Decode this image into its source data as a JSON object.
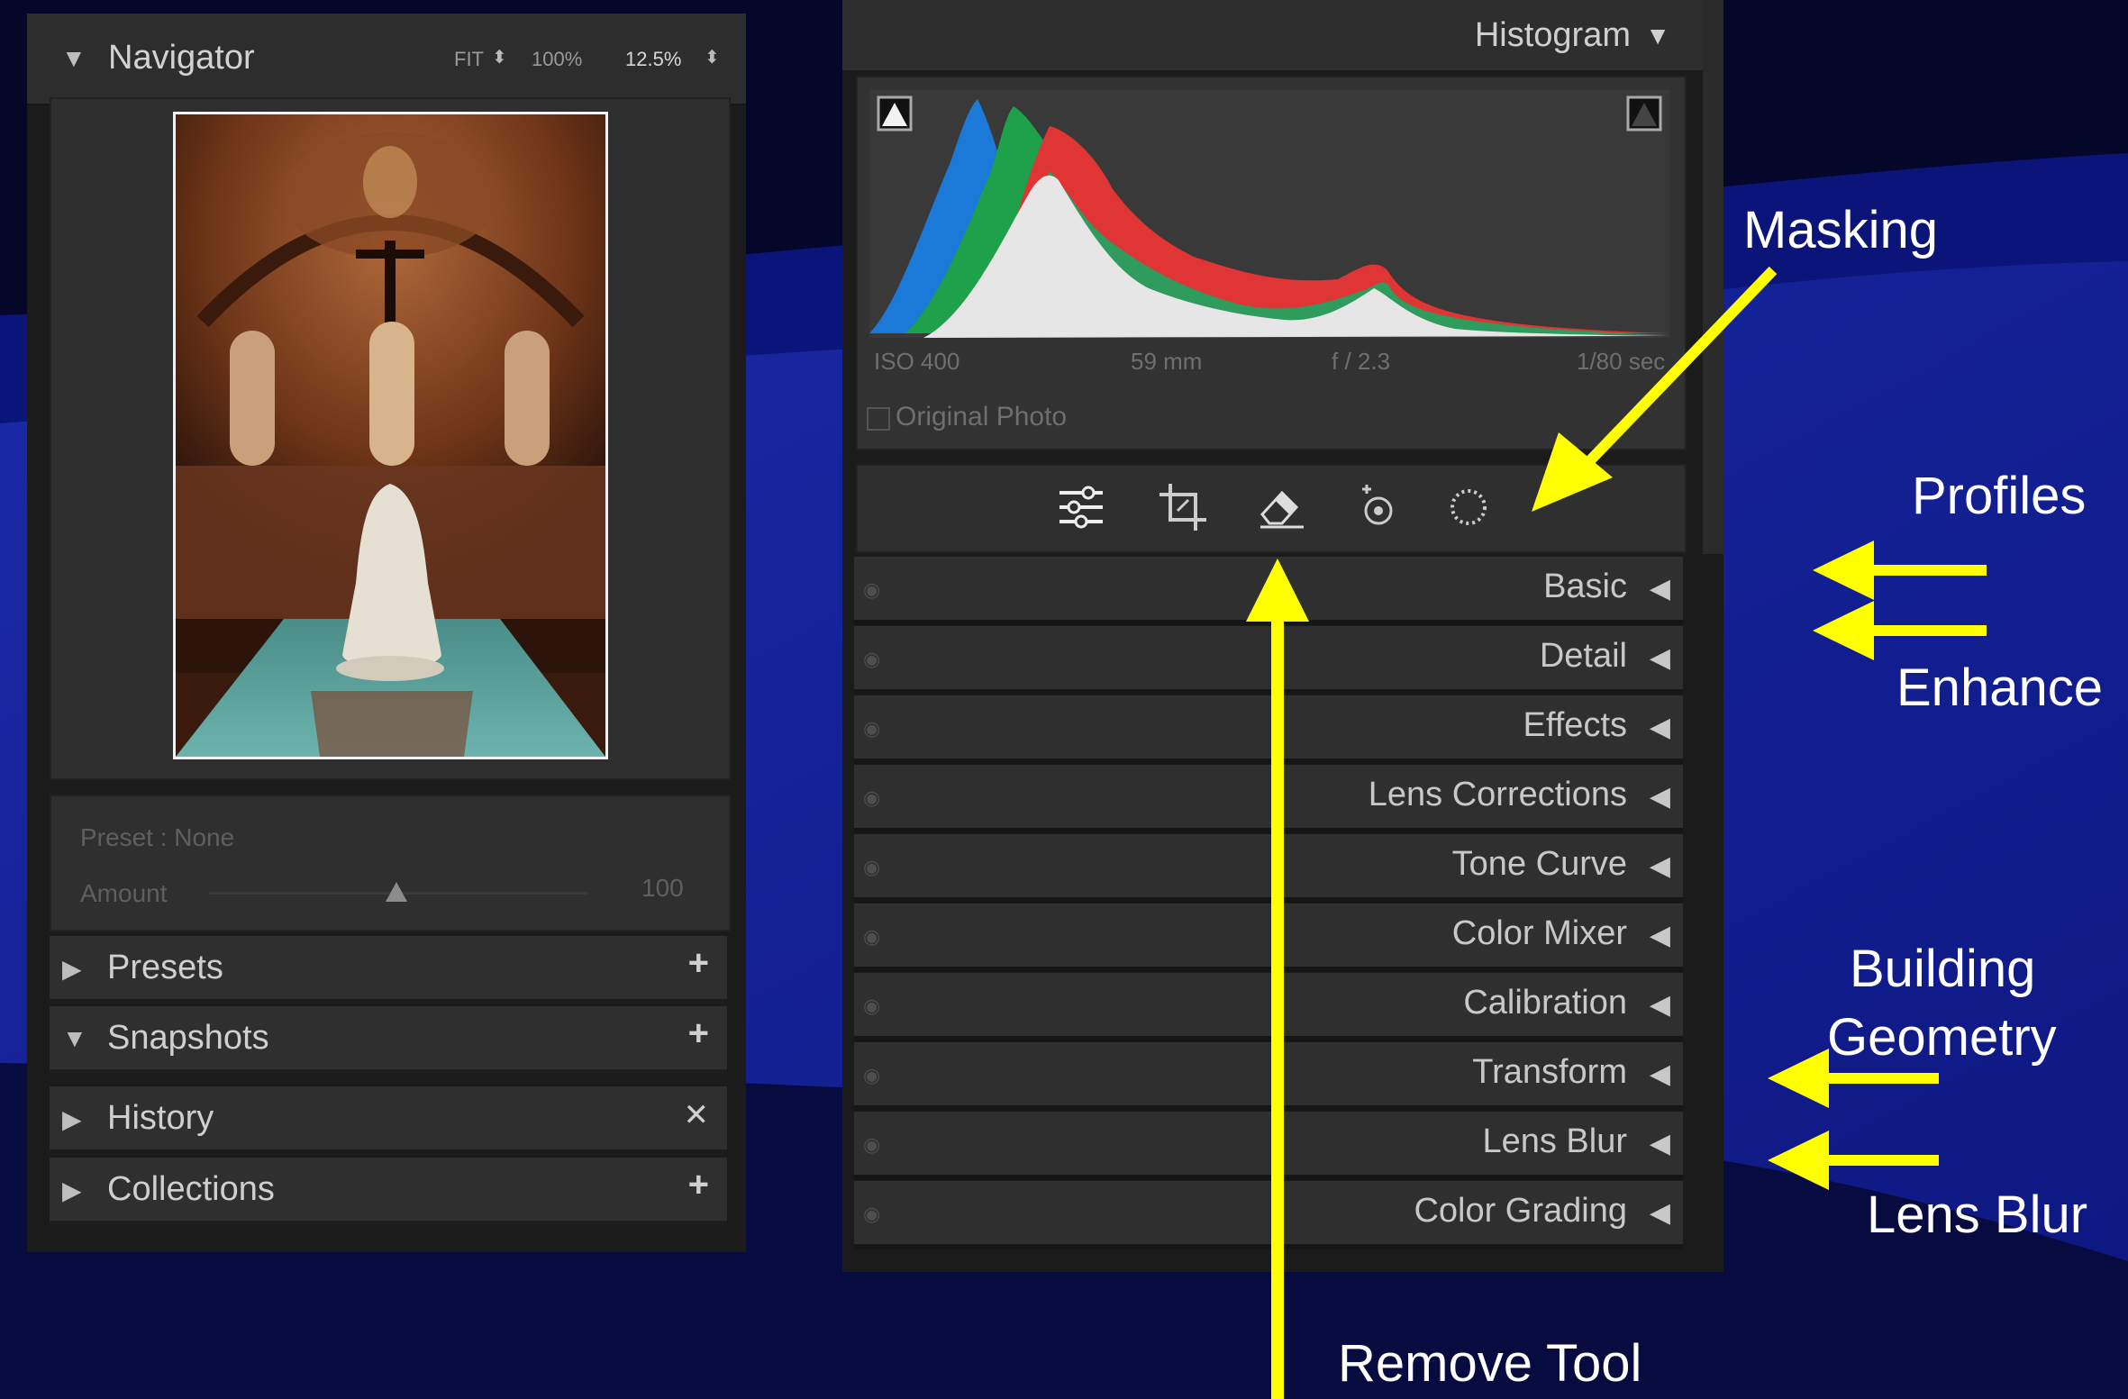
{
  "left_panel": {
    "navigator": {
      "title": "Navigator",
      "zoom_options": [
        "FIT",
        "100%",
        "12.5%"
      ]
    },
    "preset": {
      "label": "Preset : None",
      "amount_label": "Amount",
      "amount_value": "100",
      "amount_fraction": 0.5
    },
    "sections": [
      {
        "label": "Presets",
        "expanded": false,
        "action_icon": "plus-icon"
      },
      {
        "label": "Snapshots",
        "expanded": true,
        "action_icon": "plus-icon"
      },
      {
        "label": "History",
        "expanded": false,
        "action_icon": "close-icon"
      },
      {
        "label": "Collections",
        "expanded": false,
        "action_icon": "plus-icon"
      }
    ]
  },
  "right_panel": {
    "histogram": {
      "title": "Histogram",
      "iso": "ISO 400",
      "focal": "59 mm",
      "aperture": "f / 2.3",
      "shutter": "1/80 sec",
      "original_photo": "Original Photo"
    },
    "tools": [
      "edit-sliders-icon",
      "crop-icon",
      "remove-eraser-icon",
      "red-eye-icon",
      "masking-icon"
    ],
    "panels": [
      "Basic",
      "Detail",
      "Effects",
      "Lens Corrections",
      "Tone Curve",
      "Color Mixer",
      "Calibration",
      "Transform",
      "Lens Blur",
      "Color Grading"
    ]
  },
  "annotations": {
    "masking": "Masking",
    "profiles": "Profiles",
    "enhance": "Enhance",
    "building_geometry_1": "Building",
    "building_geometry_2": "Geometry",
    "lens_blur": "Lens Blur",
    "remove_tool": "Remove Tool"
  },
  "colors": {
    "arrow": "#ffff00",
    "background": "#0a1070"
  }
}
